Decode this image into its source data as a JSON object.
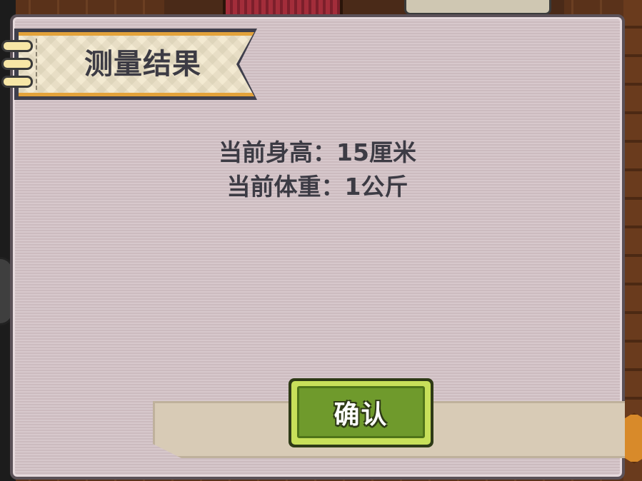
{
  "dialog": {
    "title": "测量结果",
    "results": [
      {
        "label": "当前身高",
        "separator": "：",
        "value": "15厘米"
      },
      {
        "label": "当前体重",
        "separator": "：",
        "value": "1公斤"
      }
    ],
    "confirm_label": "确认"
  },
  "icons": {
    "banner_rings": "notebook-rings-icon"
  },
  "colors": {
    "panel": "#d3c2c6",
    "title_text": "#3c3b44",
    "banner_accent": "#e3a23a",
    "button_face": "#6f9a2c",
    "button_highlight": "#c8e05a"
  }
}
